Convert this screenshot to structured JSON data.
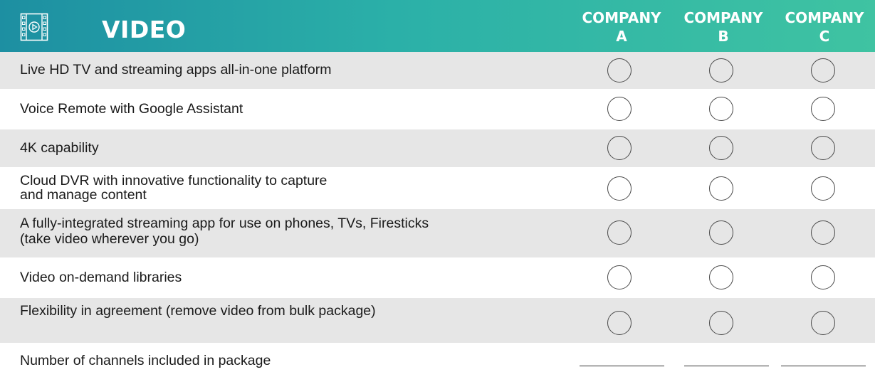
{
  "header": {
    "title": "VIDEO",
    "icon": "video-play-icon",
    "gradient": [
      "#1d8fa2",
      "#3fc3a2"
    ],
    "columns": [
      {
        "line1": "COMPANY",
        "line2": "A"
      },
      {
        "line1": "COMPANY",
        "line2": "B"
      },
      {
        "line1": "COMPANY",
        "line2": "C"
      }
    ]
  },
  "rows": [
    {
      "label": "Live HD TV and streaming apps all-in-one platform"
    },
    {
      "label": "Voice Remote with Google Assistant"
    },
    {
      "label": "4K capability"
    },
    {
      "label_lines": [
        "Cloud DVR with innovative functionality to capture",
        "and manage content"
      ]
    },
    {
      "label_lines": [
        "A fully-integrated streaming app for use on phones, TVs, Firesticks",
        "(take video wherever you go)"
      ]
    },
    {
      "label": "Video on-demand libraries"
    },
    {
      "label": "Flexibility in agreement (remove video from bulk package)"
    }
  ],
  "channels_row": {
    "label": "Number of channels included in package",
    "values": [
      "",
      "",
      ""
    ]
  },
  "colors": {
    "row_shade": "#e6e6e6",
    "header_text": "#ffffff"
  }
}
